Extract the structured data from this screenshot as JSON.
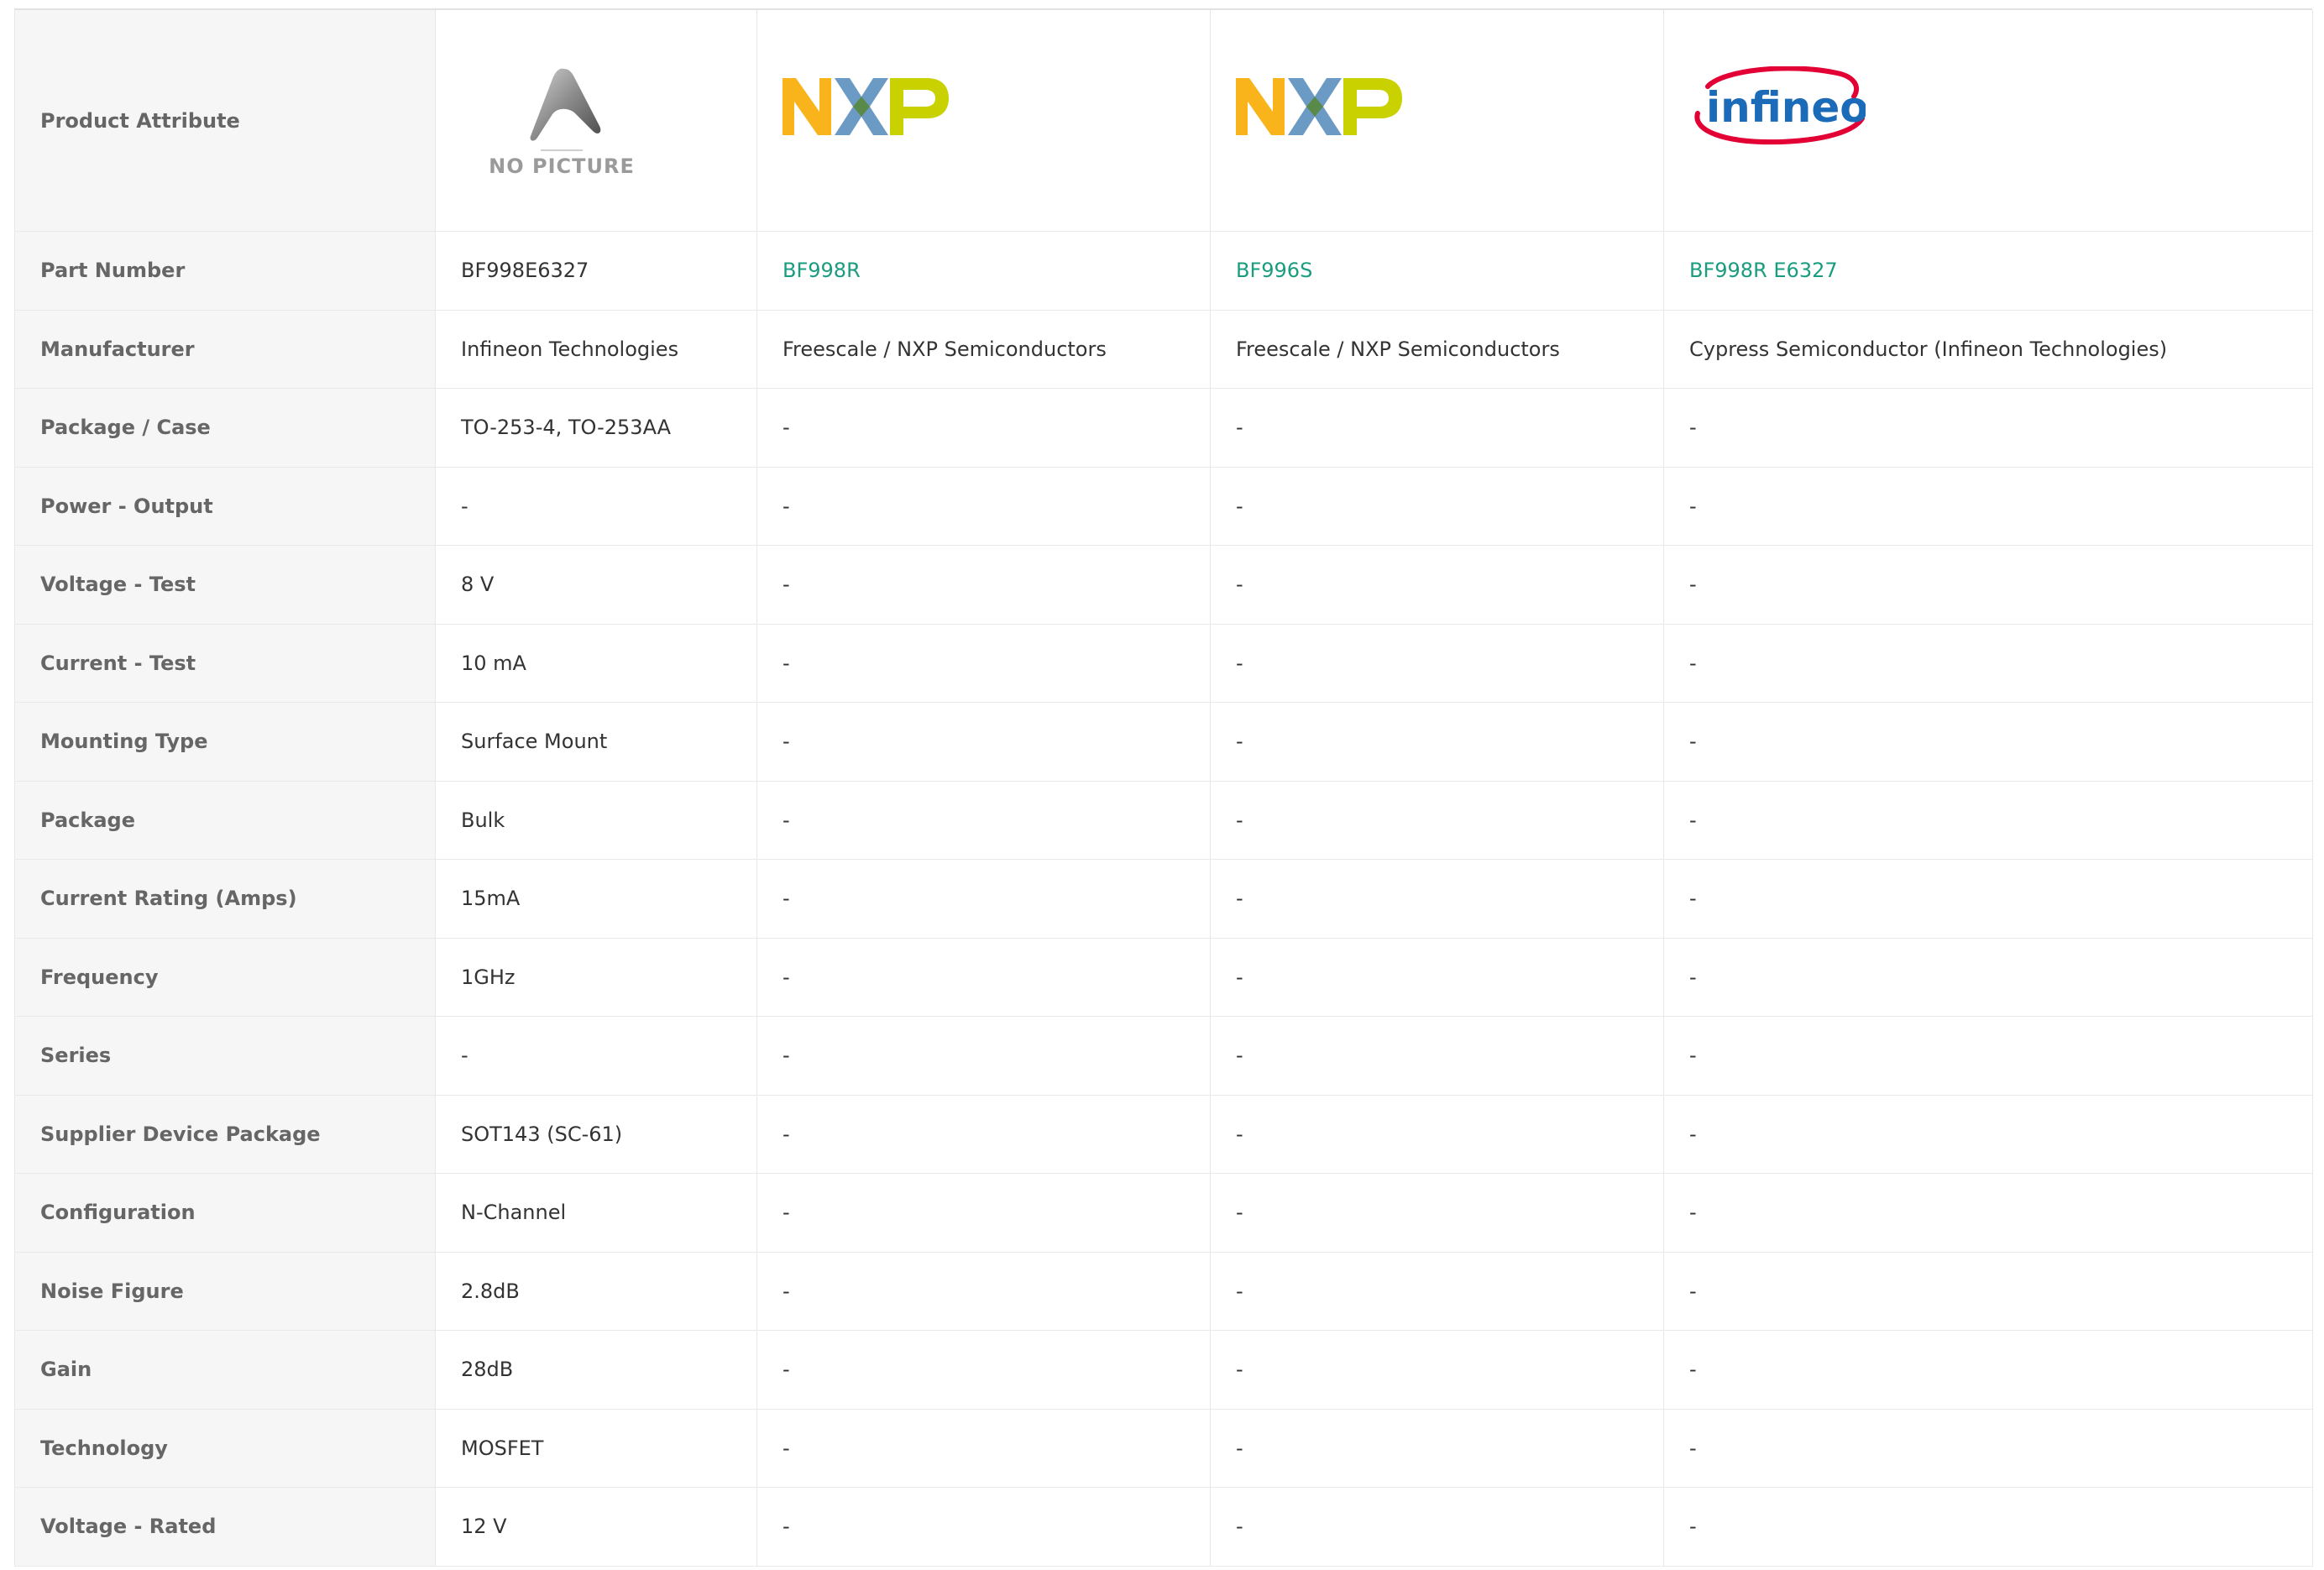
{
  "header": {
    "attribute_label": "Product Attribute",
    "no_picture_label": "NO PICTURE",
    "products": [
      {
        "logo": "no-picture"
      },
      {
        "logo": "nxp-logo",
        "logo_text": "NXP"
      },
      {
        "logo": "nxp-logo",
        "logo_text": "NXP"
      },
      {
        "logo": "infineon-logo",
        "logo_text": "infineon"
      }
    ]
  },
  "colors": {
    "link": "#1a9c7f",
    "label_bg": "#f6f6f6",
    "nxp_yellow": "#f8b41a",
    "nxp_blue": "#6b9ac4",
    "nxp_green": "#c9d200",
    "infineon_blue": "#1b6bb8",
    "infineon_red": "#e30034"
  },
  "rows": [
    {
      "label": "Part Number",
      "values": [
        "BF998E6327",
        "BF998R",
        "BF996S",
        "BF998R E6327"
      ]
    },
    {
      "label": "Manufacturer",
      "values": [
        "Infineon Technologies",
        "Freescale / NXP Semiconductors",
        "Freescale / NXP Semiconductors",
        "Cypress Semiconductor (Infineon Technologies)"
      ]
    },
    {
      "label": "Package / Case",
      "values": [
        "TO-253-4, TO-253AA",
        "-",
        "-",
        "-"
      ]
    },
    {
      "label": "Power - Output",
      "values": [
        "-",
        "-",
        "-",
        "-"
      ]
    },
    {
      "label": "Voltage - Test",
      "values": [
        "8 V",
        "-",
        "-",
        "-"
      ]
    },
    {
      "label": "Current - Test",
      "values": [
        "10 mA",
        "-",
        "-",
        "-"
      ]
    },
    {
      "label": "Mounting Type",
      "values": [
        "Surface Mount",
        "-",
        "-",
        "-"
      ]
    },
    {
      "label": "Package",
      "values": [
        "Bulk",
        "-",
        "-",
        "-"
      ]
    },
    {
      "label": "Current Rating (Amps)",
      "values": [
        "15mA",
        "-",
        "-",
        "-"
      ]
    },
    {
      "label": "Frequency",
      "values": [
        "1GHz",
        "-",
        "-",
        "-"
      ]
    },
    {
      "label": "Series",
      "values": [
        "-",
        "-",
        "-",
        "-"
      ]
    },
    {
      "label": "Supplier Device Package",
      "values": [
        "SOT143 (SC-61)",
        "-",
        "-",
        "-"
      ]
    },
    {
      "label": "Configuration",
      "values": [
        "N-Channel",
        "-",
        "-",
        "-"
      ]
    },
    {
      "label": "Noise Figure",
      "values": [
        "2.8dB",
        "-",
        "-",
        "-"
      ]
    },
    {
      "label": "Gain",
      "values": [
        "28dB",
        "-",
        "-",
        "-"
      ]
    },
    {
      "label": "Technology",
      "values": [
        "MOSFET",
        "-",
        "-",
        "-"
      ]
    },
    {
      "label": "Voltage - Rated",
      "values": [
        "12 V",
        "-",
        "-",
        "-"
      ]
    }
  ]
}
